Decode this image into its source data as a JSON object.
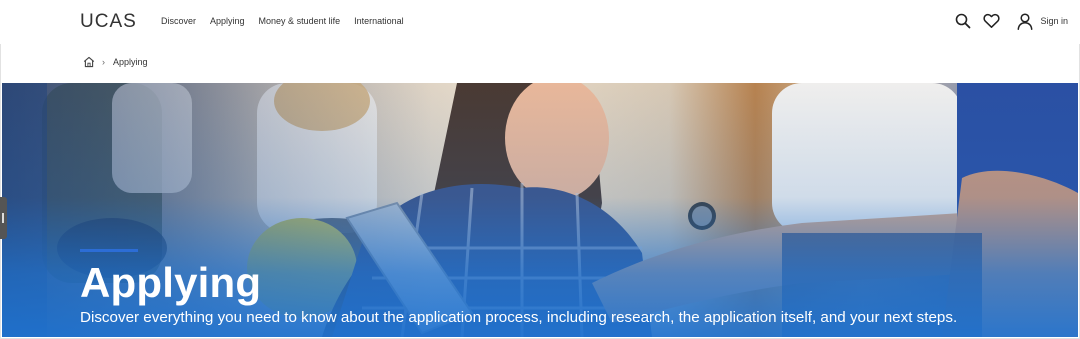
{
  "brand": {
    "logo_text": "UCAS"
  },
  "nav": {
    "items": [
      {
        "label": "Discover"
      },
      {
        "label": "Applying"
      },
      {
        "label": "Money & student life"
      },
      {
        "label": "International"
      }
    ]
  },
  "actions": {
    "search_icon": "search-icon",
    "favourites_icon": "heart-icon",
    "user_icon": "user-icon",
    "signin_label": "Sign in"
  },
  "breadcrumb": {
    "home_icon": "home-icon",
    "separator": "›",
    "current": "Applying"
  },
  "hero": {
    "title": "Applying",
    "subtitle": "Discover everything you need to know about the application process, including research, the application itself, and your next steps.",
    "accent_color": "#2c6dd6",
    "overlay_color": "#1e73d2"
  }
}
